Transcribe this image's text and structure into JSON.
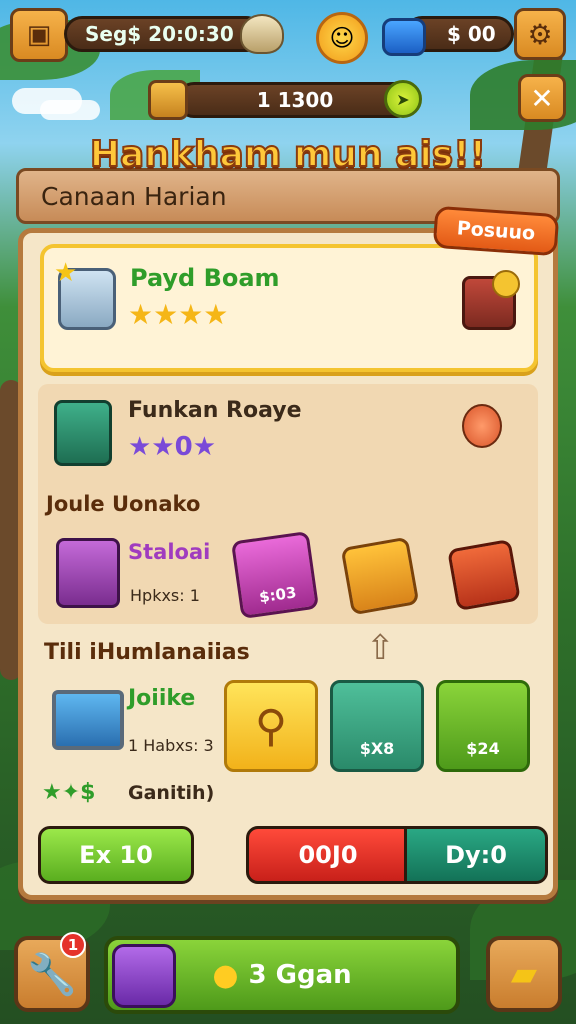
{
  "topbar": {
    "currency_left": "Seg$ 20:0:30",
    "energy": "1 1300",
    "currency_right": "$ 00"
  },
  "title": "Hankham mun ais!!",
  "banner": {
    "label": "Canaan Harian"
  },
  "tag": {
    "label": "Posuuo"
  },
  "card1": {
    "name": "Payd Boam",
    "stars": "★★★★"
  },
  "section2": {
    "name": "Funkan Roaye",
    "stars": "★★0★",
    "sub_label": "Joule Uonako",
    "item_name": "Staloai",
    "item_count": "Hpkxs: 1",
    "prices": [
      "$:03"
    ]
  },
  "section3": {
    "label": "Tili iHumlanaiias",
    "item_name": "Joiike",
    "item_count": "1 Habxs: 3",
    "gain_label": "Ganitih)",
    "prices": [
      "$X8",
      "$24"
    ]
  },
  "buttons": {
    "left": "Ex 10",
    "middle": "00J0",
    "right": "Dy:0"
  },
  "bottom": {
    "badge_left": "1",
    "main_label": "3 Ggan"
  },
  "colors": {
    "accent_green": "#2f9d2a",
    "button_green": "#7ccf2f",
    "button_red": "#e22a26",
    "button_teal": "#1d8f6f",
    "gold": "#f4c430"
  }
}
